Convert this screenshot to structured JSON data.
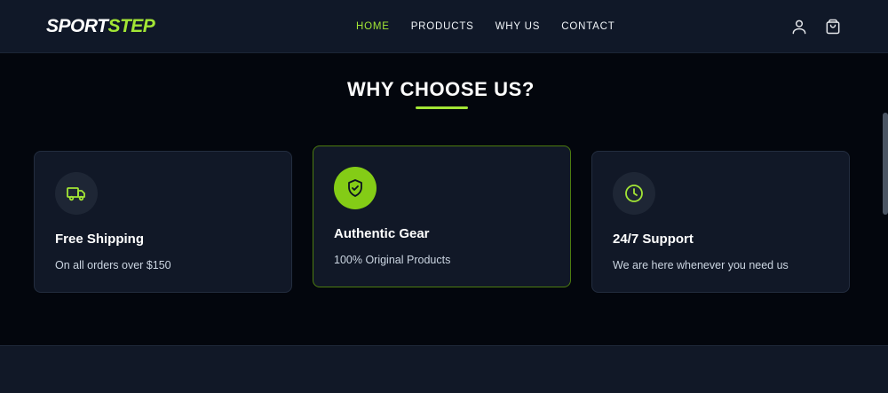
{
  "brand": {
    "part1": "SPORT",
    "part2": "STEP"
  },
  "nav": {
    "items": [
      {
        "label": "HOME",
        "active": true
      },
      {
        "label": "PRODUCTS",
        "active": false
      },
      {
        "label": "WHY US",
        "active": false
      },
      {
        "label": "CONTACT",
        "active": false
      }
    ]
  },
  "header_icons": [
    "user-icon",
    "shopping-bag-icon"
  ],
  "section": {
    "title": "WHY CHOOSE US?",
    "cards": [
      {
        "icon": "truck-icon",
        "title": "Free Shipping",
        "subtitle": "On all orders over $150",
        "highlighted": false
      },
      {
        "icon": "shield-check-icon",
        "title": "Authentic Gear",
        "subtitle": "100% Original Products",
        "highlighted": true
      },
      {
        "icon": "clock-icon",
        "title": "24/7 Support",
        "subtitle": "We are here whenever you need us",
        "highlighted": false
      }
    ]
  },
  "colors": {
    "accent": "#a3e635",
    "background": "#03060d",
    "surface": "#111827"
  }
}
